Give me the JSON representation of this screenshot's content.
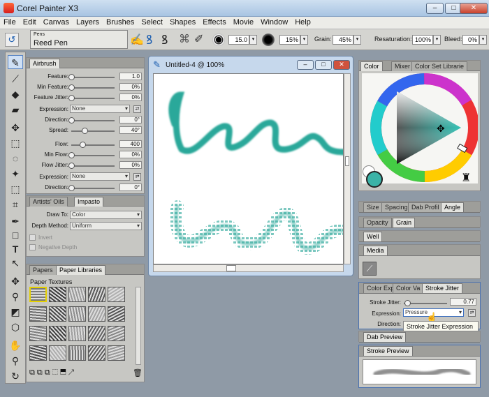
{
  "app": {
    "title": "Corel Painter X3"
  },
  "menu": [
    "File",
    "Edit",
    "Canvas",
    "Layers",
    "Brushes",
    "Select",
    "Shapes",
    "Effects",
    "Movie",
    "Window",
    "Help"
  ],
  "props": {
    "category": "Pens",
    "variant": "Reed Pen",
    "size": "15.0",
    "opacity": "15%",
    "grain_label": "Grain:",
    "grain": "45%",
    "resat_label": "Resaturation:",
    "resat": "100%",
    "bleed_label": "Bleed:",
    "bleed": "0%"
  },
  "brush_controls": {
    "tabs": [
      "Airbrush"
    ],
    "rows": [
      {
        "label": "Feature:",
        "value": "1.0",
        "pos": 0
      },
      {
        "label": "Min Feature:",
        "value": "0%",
        "pos": 0
      },
      {
        "label": "Feature Jitter:",
        "value": "0%",
        "pos": 0
      }
    ],
    "expression_label": "Expression:",
    "expression_value": "None",
    "direction_label": "Direction:",
    "direction_value": "0°",
    "spread_label": "Spread:",
    "spread_value": "40°",
    "spread_pos": 0.31,
    "rows2": [
      {
        "label": "Flow:",
        "value": "400",
        "pos": 0.25
      },
      {
        "label": "Min Flow:",
        "value": "0%",
        "pos": 0
      },
      {
        "label": "Flow Jitter:",
        "value": "0%",
        "pos": 0
      }
    ],
    "expression2_label": "Expression:",
    "expression2_value": "None",
    "direction2_label": "Direction:",
    "direction2_value": "0°"
  },
  "impasto": {
    "tabs": [
      "Artists' Oils",
      "Impasto"
    ],
    "draw_to_label": "Draw To:",
    "draw_to": "Color",
    "depth_label": "Depth Method:",
    "depth": "Uniform",
    "invert": "Invert",
    "negative": "Negative Depth"
  },
  "papers": {
    "tabs": [
      "Papers",
      "Paper Libraries"
    ],
    "heading": "Paper Textures"
  },
  "document": {
    "title": "Untitled-4 @ 100%"
  },
  "color_panel": {
    "tabs": [
      "Color",
      "Mixer",
      "Color Set Librarie"
    ],
    "main_color": "#3bb3a7"
  },
  "dab_panel": {
    "tabs": [
      "Size",
      "Spacing",
      "Dab Profil",
      "Angle"
    ]
  },
  "opacity_panel": {
    "tabs": [
      "Opacity",
      "Grain"
    ]
  },
  "well_panel": {
    "tabs": [
      "Well"
    ]
  },
  "media_panel": {
    "tabs": [
      "Media"
    ]
  },
  "jitter_panel": {
    "tabs": [
      "Color Exp",
      "Color Va",
      "Stroke Jitter"
    ],
    "jitter_label": "Stroke Jitter:",
    "jitter_value": "0.77",
    "jitter_pos": 0.08,
    "expression_label": "Expression:",
    "expression_value": "Pressure",
    "direction_label": "Direction:"
  },
  "tooltip": "Stroke Jitter Expression",
  "dab_preview": {
    "tabs": [
      "Dab Preview"
    ]
  },
  "stroke_preview": {
    "tabs": [
      "Stroke Preview"
    ]
  },
  "stroke_color": "#2fa99b"
}
